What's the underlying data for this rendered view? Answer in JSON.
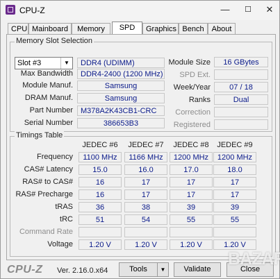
{
  "window": {
    "title": "CPU-Z",
    "minimize": "—",
    "maximize": "☐",
    "close": "✕"
  },
  "tabs": [
    "CPU",
    "Mainboard",
    "Memory",
    "SPD",
    "Graphics",
    "Bench",
    "About"
  ],
  "active_tab": "SPD",
  "slot": {
    "group_title": "Memory Slot Selection",
    "selected": "Slot #3",
    "type": "DDR4 (UDIMM)",
    "rows": {
      "max_bandwidth": {
        "label": "Max Bandwidth",
        "value": "DDR4-2400 (1200 MHz)"
      },
      "module_manuf": {
        "label": "Module Manuf.",
        "value": "Samsung"
      },
      "dram_manuf": {
        "label": "DRAM Manuf.",
        "value": "Samsung"
      },
      "part_number": {
        "label": "Part Number",
        "value": "M378A2K43CB1-CRC"
      },
      "serial_number": {
        "label": "Serial Number",
        "value": "386653B3"
      }
    },
    "right": {
      "module_size": {
        "label": "Module Size",
        "value": "16 GBytes"
      },
      "spd_ext": {
        "label": "SPD Ext.",
        "value": ""
      },
      "week_year": {
        "label": "Week/Year",
        "value": "07 / 18"
      },
      "ranks": {
        "label": "Ranks",
        "value": "Dual"
      },
      "correction": {
        "label": "Correction",
        "value": ""
      },
      "registered": {
        "label": "Registered",
        "value": ""
      }
    }
  },
  "timings": {
    "group_title": "Timings Table",
    "columns": [
      "JEDEC #6",
      "JEDEC #7",
      "JEDEC #8",
      "JEDEC #9"
    ],
    "rows": [
      {
        "label": "Frequency",
        "values": [
          "1100 MHz",
          "1166 MHz",
          "1200 MHz",
          "1200 MHz"
        ]
      },
      {
        "label": "CAS# Latency",
        "values": [
          "15.0",
          "16.0",
          "17.0",
          "18.0"
        ]
      },
      {
        "label": "RAS# to CAS#",
        "values": [
          "16",
          "17",
          "17",
          "17"
        ]
      },
      {
        "label": "RAS# Precharge",
        "values": [
          "16",
          "17",
          "17",
          "17"
        ]
      },
      {
        "label": "tRAS",
        "values": [
          "36",
          "38",
          "39",
          "39"
        ]
      },
      {
        "label": "tRC",
        "values": [
          "51",
          "54",
          "55",
          "55"
        ]
      },
      {
        "label": "Command Rate",
        "values": [
          "",
          "",
          "",
          ""
        ]
      },
      {
        "label": "Voltage",
        "values": [
          "1.20 V",
          "1.20 V",
          "1.20 V",
          "1.20 V"
        ]
      }
    ]
  },
  "footer": {
    "logo": "CPU-Z",
    "version": "Ver. 2.16.0.x64",
    "tools": "Tools",
    "tools_arrow": "▼",
    "validate": "Validate",
    "close": "Close"
  },
  "watermark": "BAZAR"
}
